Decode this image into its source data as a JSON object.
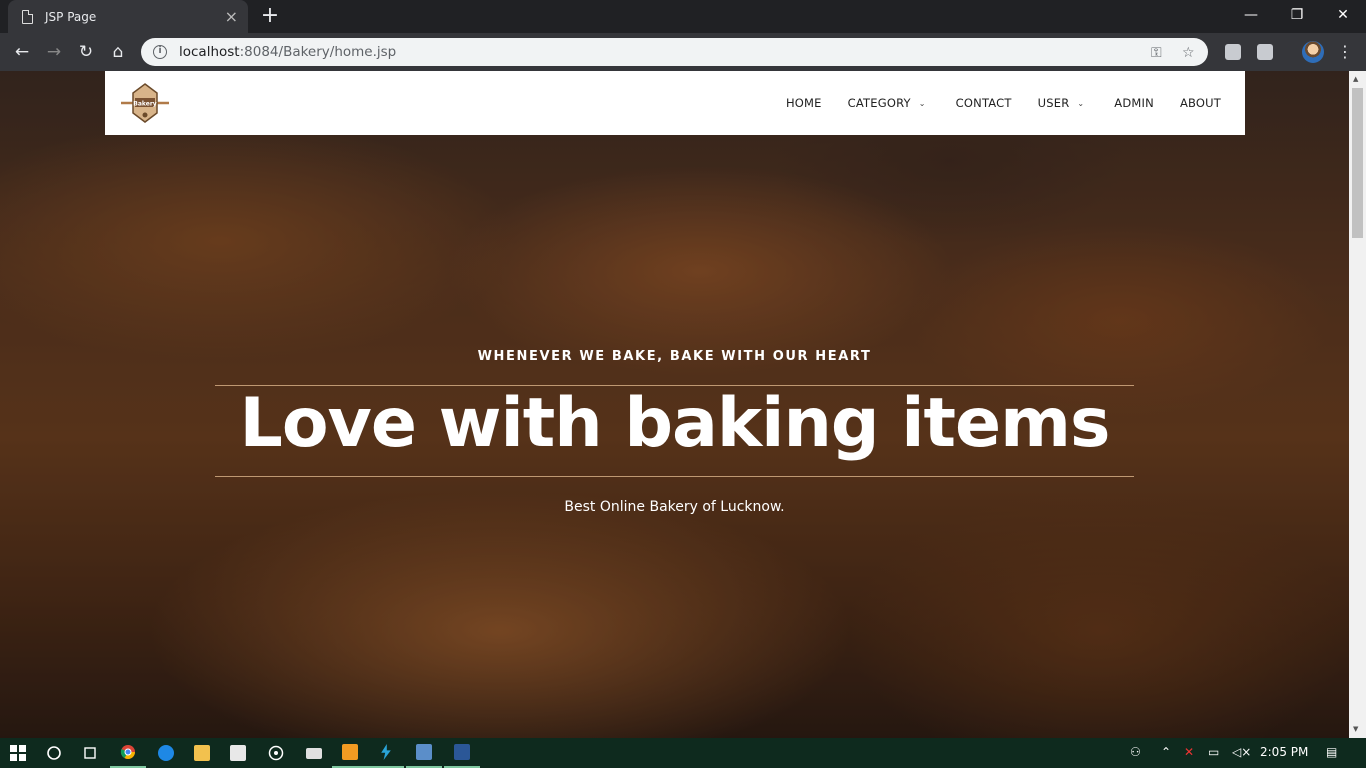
{
  "browser": {
    "tab_title": "JSP Page",
    "tab_close": "×",
    "new_tab": "+",
    "url_host": "localhost",
    "url_rest": ":8084/Bakery/home.jsp",
    "win_minimize": "—",
    "win_restore": "❐",
    "win_close": "✕"
  },
  "site": {
    "logo_text": "Bakery",
    "nav": [
      {
        "label": "HOME"
      },
      {
        "label": "CATEGORY",
        "dropdown": true
      },
      {
        "label": "CONTACT"
      },
      {
        "label": "USER",
        "dropdown": true
      },
      {
        "label": "ADMIN"
      },
      {
        "label": "ABOUT"
      }
    ]
  },
  "hero": {
    "subtitle": "WHENEVER WE BAKE, BAKE WITH OUR HEART",
    "title": "Love with baking items",
    "tagline": "Best Online Bakery of Lucknow."
  },
  "taskbar": {
    "clock": "2:05 PM"
  },
  "colors": {
    "chrome_dark": "#202124",
    "toolbar": "#35363a",
    "taskbar": "#0e2a1e",
    "hero_rule": "#d2aa82"
  }
}
